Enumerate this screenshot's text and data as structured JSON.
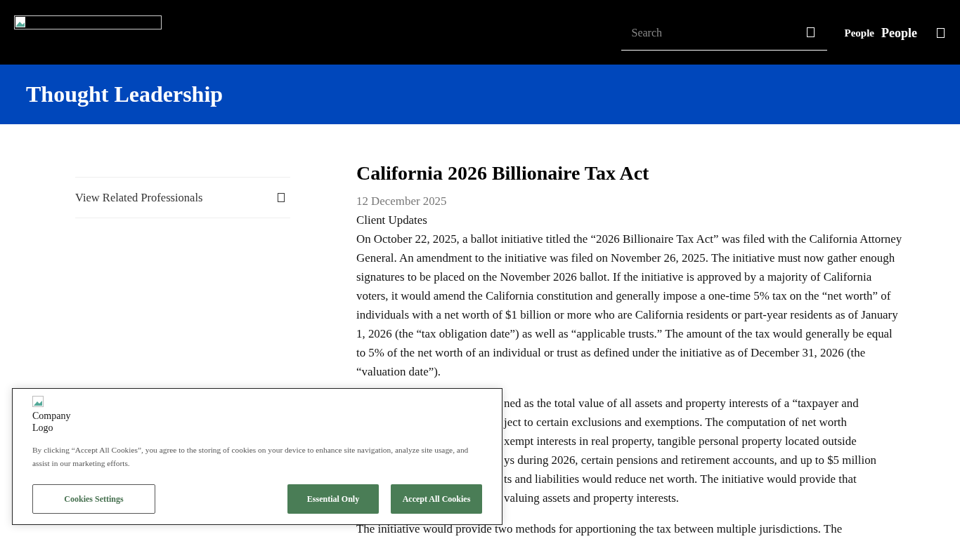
{
  "header": {
    "search": {
      "placeholder": "Search"
    },
    "people_image_alt": "People",
    "people_link": "People"
  },
  "banner": {
    "title": "Thought Leadership"
  },
  "sidebar": {
    "items": [
      {
        "label": "View Related Professionals",
        "expanded": false
      }
    ]
  },
  "article": {
    "title": "California 2026 Billionaire Tax Act",
    "date": "12 December 2025",
    "category": "Client Updates",
    "paragraphs": [
      {
        "kind": "full",
        "text": "On October 22, 2025, a ballot initiative titled the “2026 Billionaire Tax Act” was filed with the California Attorney General.  An amendment to the initiative was filed on November 26, 2025.  The initiative must now gather enough signatures to be placed on the November 2026 ballot. If the initiative is approved by a majority of California voters, it would amend the California constitution and generally impose a one-time 5% tax on the “net worth” of individuals with a net worth of $1 billion or more who are California residents or part-year residents as of January 1, 2026 (the “tax obligation date”) as well as “applicable trusts.” The amount of the tax would generally be equal to 5% of the net worth of an individual or trust as defined under the initiative as of December 31, 2026 (the “valuation date”)."
      },
      {
        "kind": "partial",
        "lines": [
          "ned as the total value of all assets and property interests of a “taxpayer and",
          "ject to certain exclusions and exemptions.  The computation of net worth",
          "xempt interests in real property, tangible personal property located outside",
          "ys during 2026, certain pensions and retirement accounts, and up to $5 million",
          "ts and liabilities would reduce net worth. The initiative would provide that",
          "valuing assets and property interests."
        ]
      },
      {
        "kind": "full",
        "text": "The initiative would provide two methods for apportioning the tax between multiple jurisdictions.  The"
      }
    ]
  },
  "cookie_banner": {
    "logo_alt": "Company Logo",
    "text": "By clicking “Accept All Cookies”, you agree to the storing of cookies on your device to enhance site navigation, analyze site usage, and assist in our marketing efforts.",
    "buttons": [
      {
        "label": "Cookies Settings",
        "kind": "outline"
      },
      {
        "label": "Essential Only",
        "kind": "filled"
      },
      {
        "label": "Accept All Cookies",
        "kind": "filled"
      }
    ]
  }
}
